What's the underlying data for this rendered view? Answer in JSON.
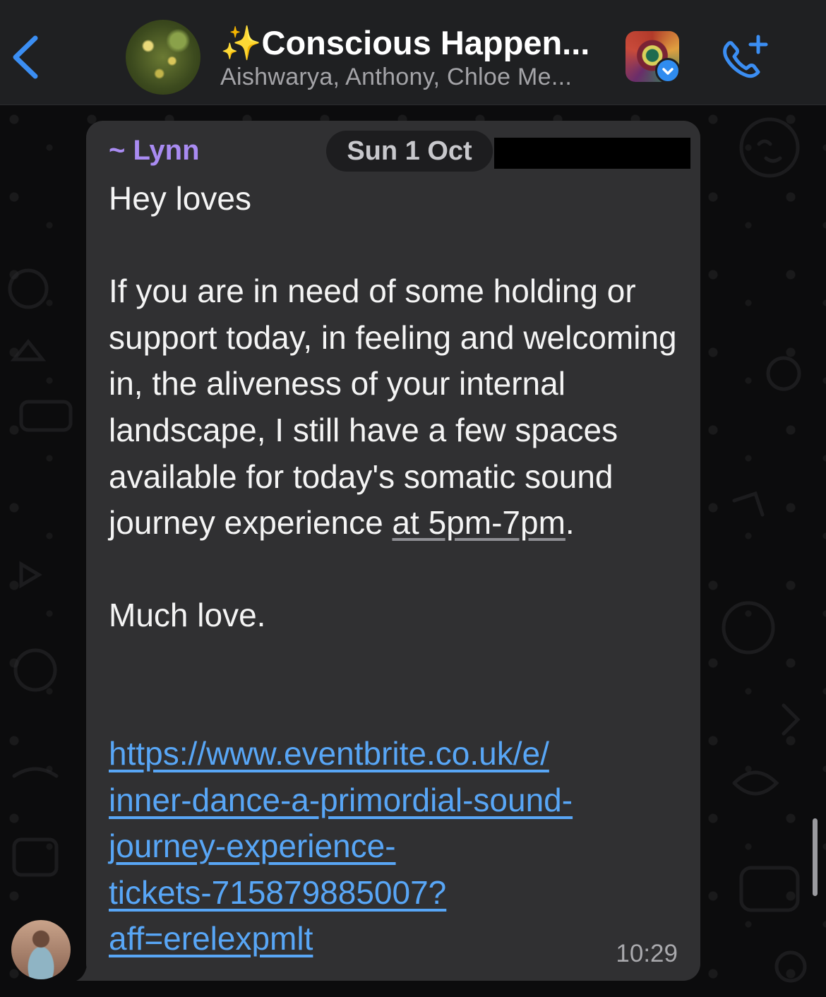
{
  "header": {
    "back_icon": "chevron-left-icon",
    "title": "✨Conscious Happen...",
    "participants": "Aishwarya, Anthony, Chloe Me...",
    "call_icon": "phone-plus-icon",
    "accent_color": "#3b8ef3"
  },
  "message": {
    "sender": "~ Lynn",
    "sender_color": "#a98bf2",
    "date": "Sun 1 Oct",
    "text_before_time": "Hey loves\n\nIf you are in need of some holding or support today, in feeling and welcoming in, the aliveness of your internal landscape, I still have a few spaces available for today's somatic sound journey experience ",
    "time_range": "at 5pm-7pm",
    "text_after_time": ".\n\nMuch love.",
    "link": "https://www.eventbrite.co.uk/e/\ninner-dance-a-primordial-sound-\njourney-experience-\ntickets-715879885007?\naff=erelexpmlt",
    "link_color": "#58a6f6",
    "time": "10:29"
  }
}
